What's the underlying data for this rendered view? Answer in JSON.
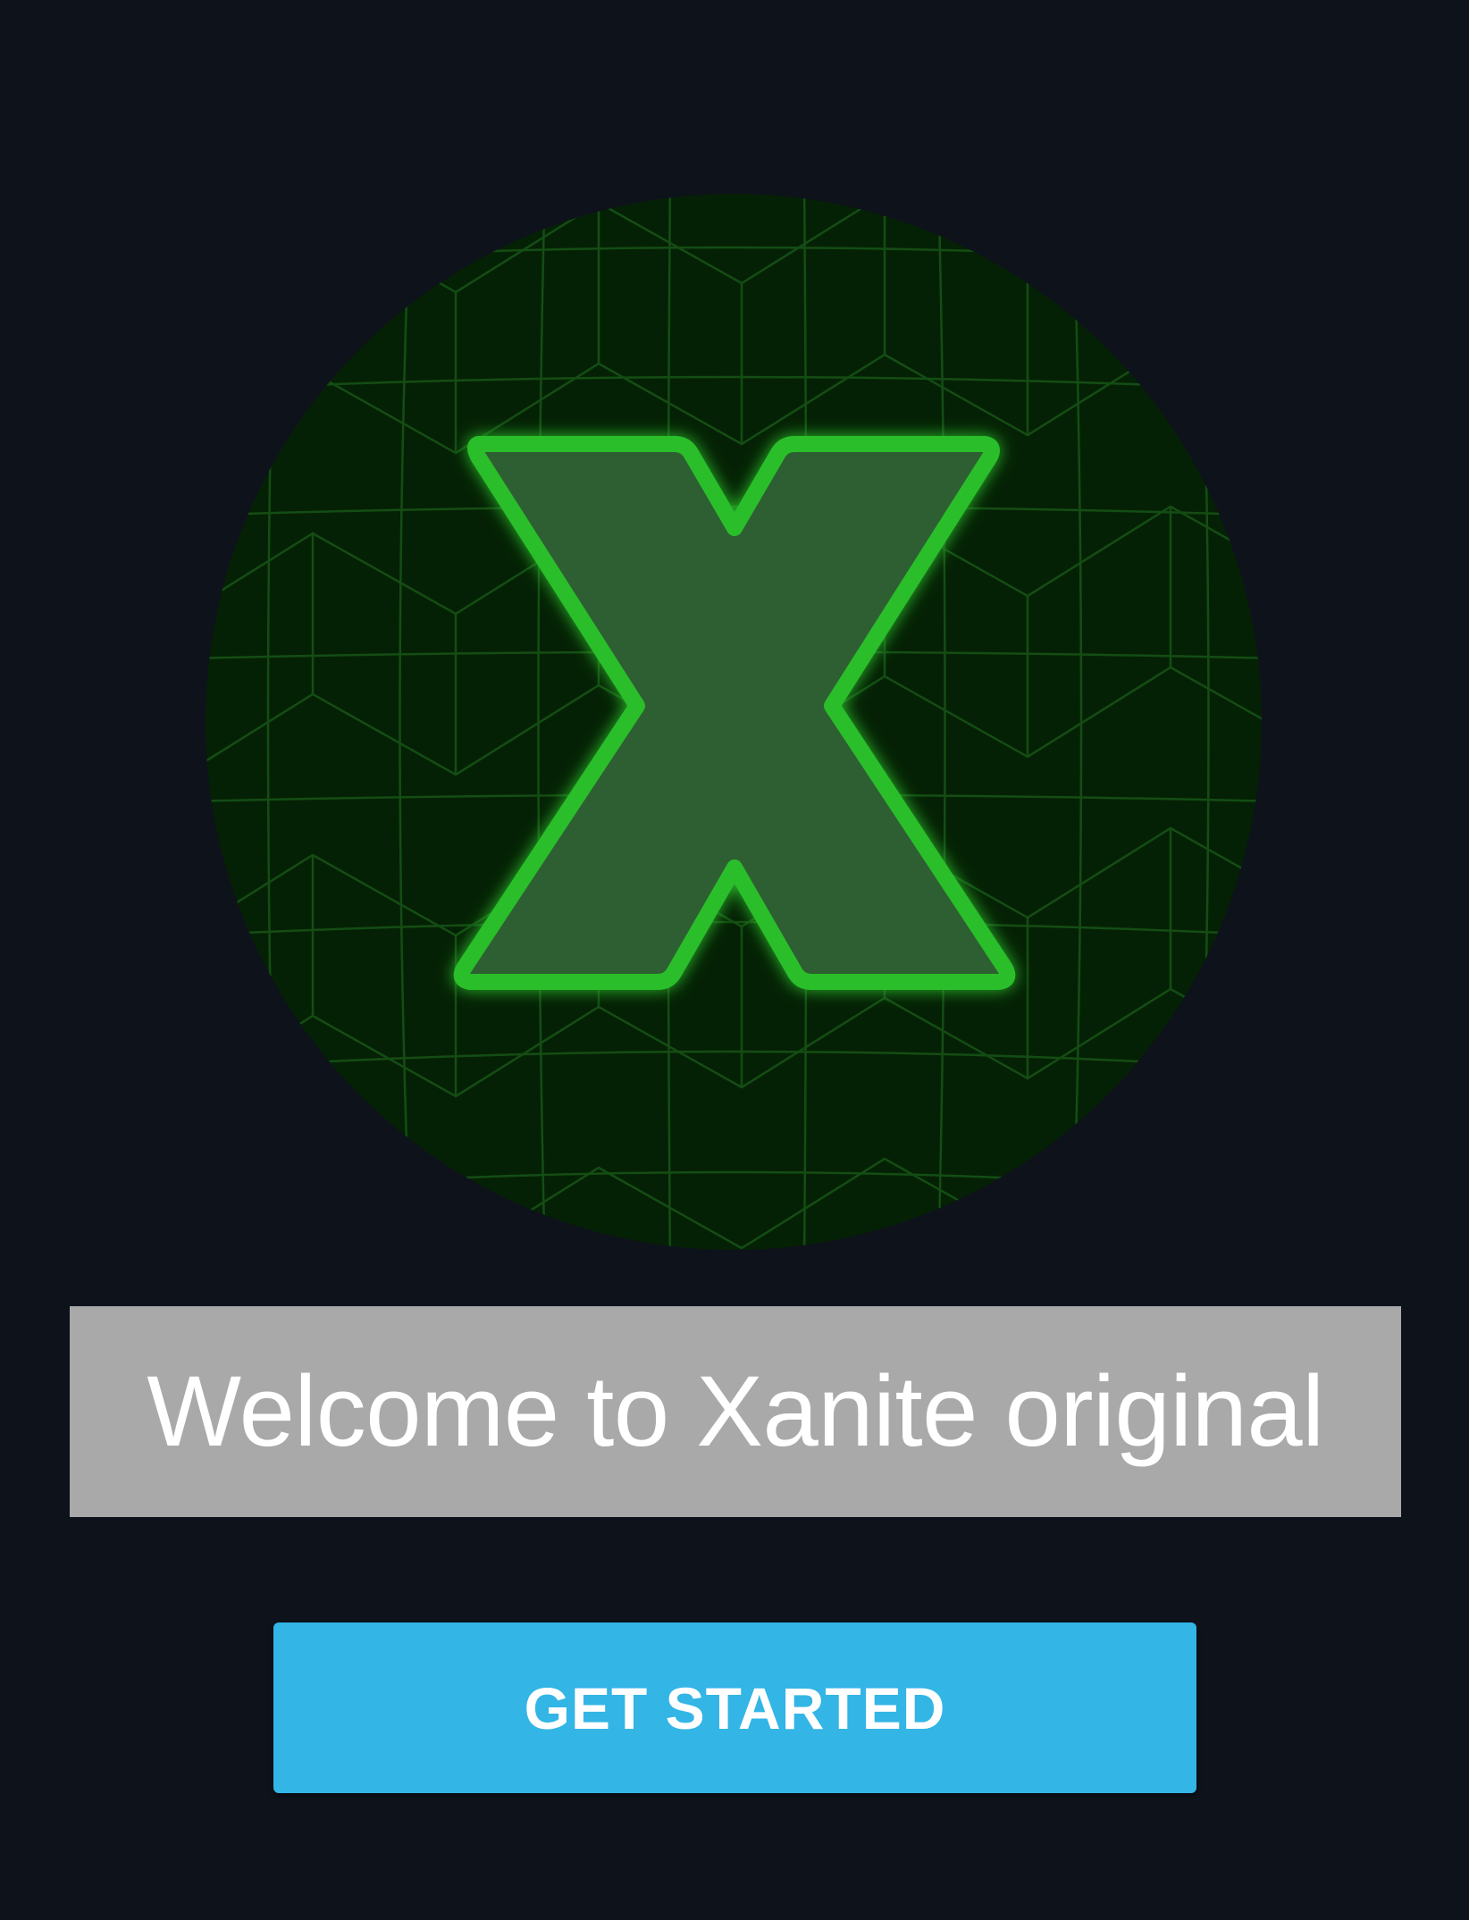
{
  "welcome": {
    "title": "Welcome to Xanite original"
  },
  "actions": {
    "get_started_label": "GET STARTED"
  },
  "logo": {
    "icon": "xanite-x-logo-icon",
    "letter": "X"
  },
  "colors": {
    "background": "#0e121b",
    "logo_circle": "#052105",
    "logo_grid": "#1a5c1a",
    "logo_outline": "#2bbf2b",
    "logo_fill": "#2d5e32",
    "banner_background": "#a9a9a9",
    "button_background": "#33b5e5",
    "button_text": "#ffffff"
  }
}
